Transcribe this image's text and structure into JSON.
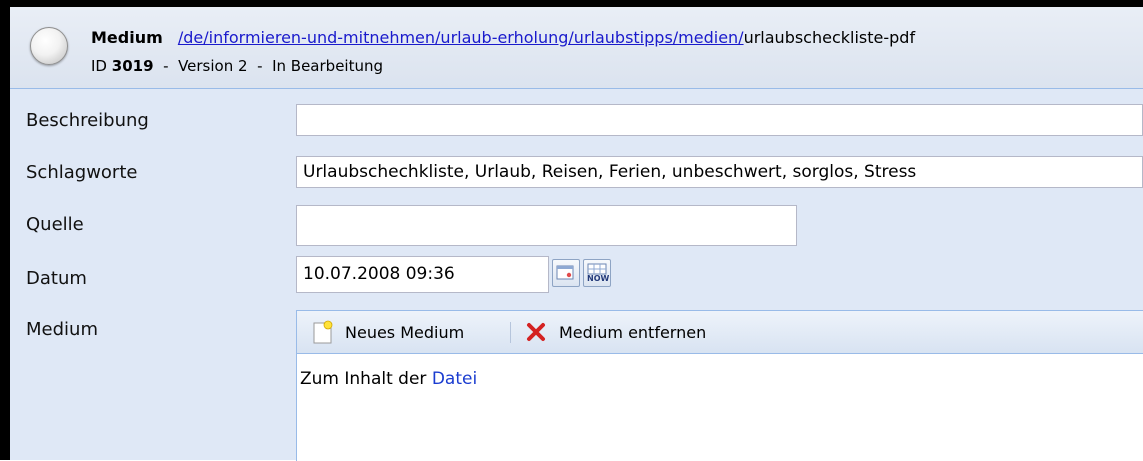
{
  "header": {
    "title": "Medium",
    "path_link": "/de/informieren-und-mitnehmen/urlaub-erholung/urlaubstipps/medien/",
    "path_end": "urlaubscheckliste-pdf",
    "id_label": "ID",
    "id_value": "3019",
    "version": "Version 2",
    "status": "In Bearbeitung",
    "separator": "-"
  },
  "form": {
    "beschreibung": {
      "label": "Beschreibung",
      "value": ""
    },
    "schlagworte": {
      "label": "Schlagworte",
      "value": "Urlaubschechkliste, Urlaub, Reisen, Ferien, unbeschwert, sorglos, Stress"
    },
    "quelle": {
      "label": "Quelle",
      "value": ""
    },
    "datum": {
      "label": "Datum",
      "value": "10.07.2008 09:36",
      "now_label": "NOW"
    },
    "medium": {
      "label": "Medium"
    }
  },
  "medium_toolbar": {
    "new_label": "Neues Medium",
    "remove_label": "Medium entfernen"
  },
  "medium_content": {
    "text": "Zum Inhalt der",
    "link": "Datei"
  },
  "colors": {
    "form_bg": "#dfe8f6",
    "border": "#99bbe8",
    "link": "#1a1acc",
    "remove_icon": "#d42222"
  }
}
